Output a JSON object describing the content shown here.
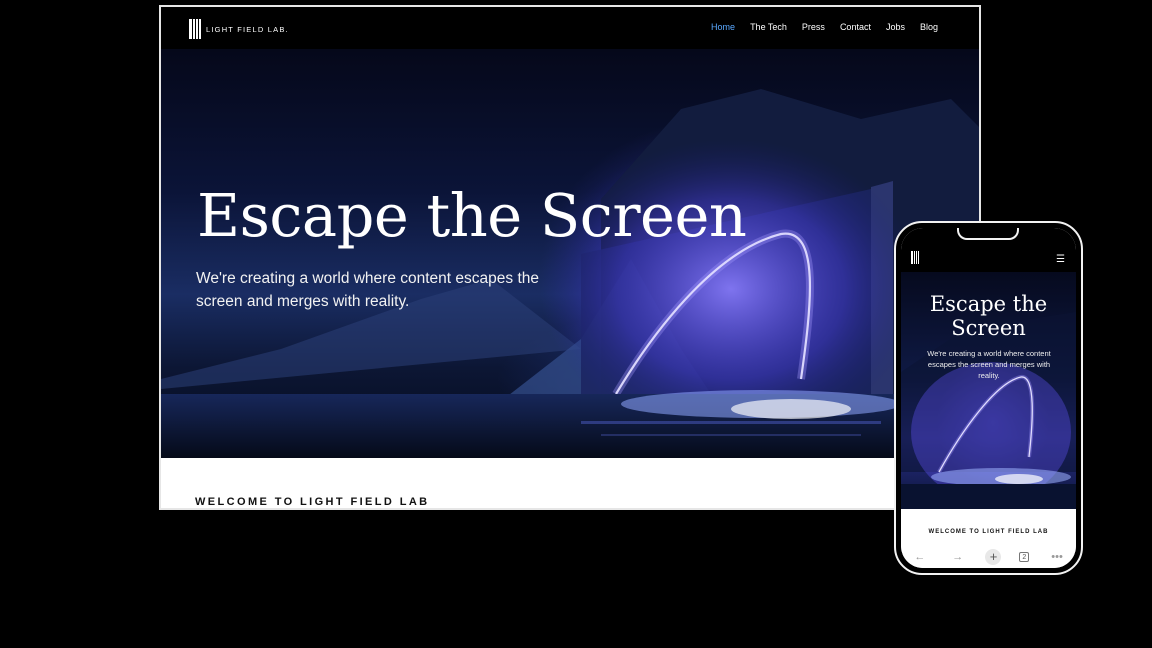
{
  "desktop": {
    "brand": "LIGHT FIELD LAB.",
    "nav": [
      {
        "label": "Home",
        "active": true
      },
      {
        "label": "The Tech",
        "active": false
      },
      {
        "label": "Press",
        "active": false
      },
      {
        "label": "Contact",
        "active": false
      },
      {
        "label": "Jobs",
        "active": false
      },
      {
        "label": "Blog",
        "active": false
      }
    ],
    "hero": {
      "title": "Escape the Screen",
      "subtitle": "We're creating a world where content escapes the screen and merges with reality."
    },
    "section_heading": "WELCOME TO LIGHT FIELD LAB"
  },
  "phone": {
    "menu_icon": "hamburger-icon",
    "hero": {
      "title": "Escape the Screen",
      "subtitle": "We're creating a world where content escapes the screen and merges with reality."
    },
    "section_heading": "WELCOME TO LIGHT FIELD LAB",
    "toolbar": {
      "back": "←",
      "forward": "→",
      "new_tab": "+",
      "tab_count": "2",
      "more": "•••"
    }
  },
  "colors": {
    "nav_active": "#5aa8ff",
    "hero_glow": "#6a5cff"
  }
}
